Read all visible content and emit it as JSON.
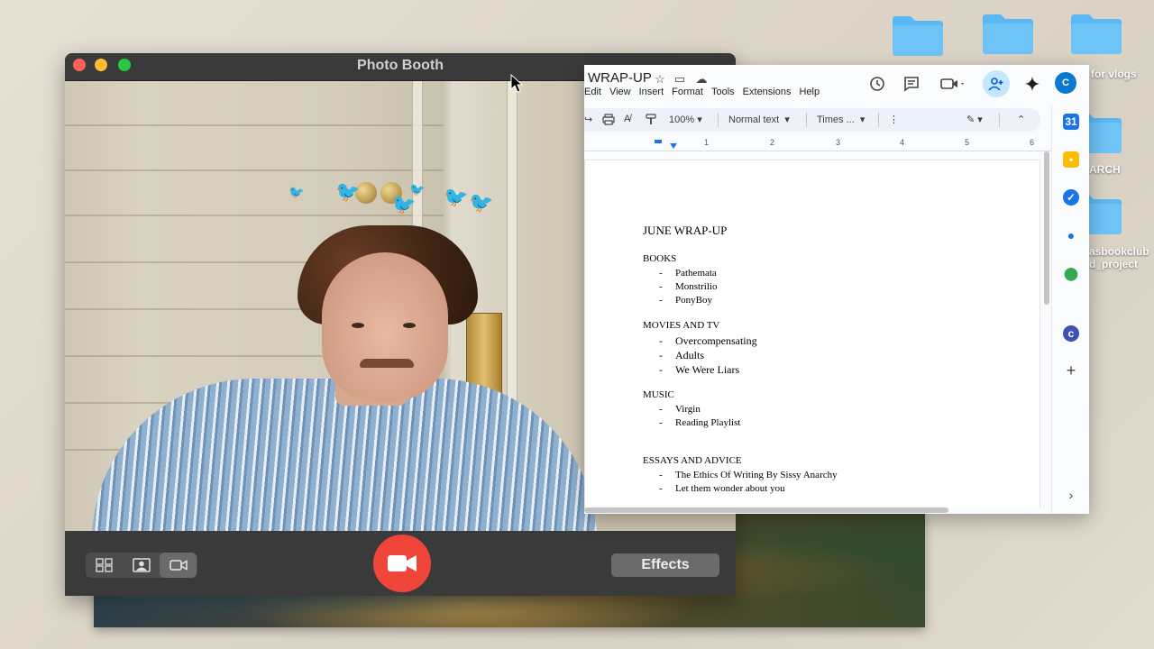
{
  "desktop": {
    "folders": [
      {
        "label": ""
      },
      {
        "label": ""
      },
      {
        "label": "for vlogs"
      },
      {
        "label": "ARCH"
      },
      {
        "label": "asbookclub\nd_project"
      }
    ],
    "folder_color": "#5ab8f5"
  },
  "photo_booth": {
    "title": "Photo Booth",
    "effects_label": "Effects",
    "view_modes": [
      "grid-icon",
      "portrait-icon",
      "video-icon"
    ],
    "active_mode": "video",
    "record_color": "#f0453a"
  },
  "doc": {
    "title": "WRAP-UP",
    "menu": [
      "Edit",
      "View",
      "Insert",
      "Format",
      "Tools",
      "Extensions",
      "Help"
    ],
    "toolbar": {
      "zoom": "100%",
      "style": "Normal text",
      "font": "Times ..."
    },
    "ruler": [
      "1",
      "2",
      "3",
      "4",
      "5",
      "6"
    ],
    "avatar_letter": "C",
    "heading": "JUNE WRAP-UP",
    "sections": [
      {
        "title": "BOOKS",
        "items": [
          "Pathemata",
          "Monstrilio",
          "PonyBoy"
        ]
      },
      {
        "title": "MOVIES AND TV",
        "items": [
          "Overcompensating",
          "Adults",
          "We Were Liars"
        ]
      },
      {
        "title": "MUSIC",
        "items": [
          "Virgin",
          "Reading Playlist"
        ]
      },
      {
        "title": "ESSAYS AND ADVICE",
        "items": [
          "The Ethics Of Writing By Sissy Anarchy",
          "Let them wonder about you"
        ]
      }
    ],
    "side_panel_colors": [
      "#1a73e8",
      "#fbbc04",
      "#1a73e8",
      "#1a73e8",
      "#34a853",
      "#3f51b5"
    ]
  }
}
